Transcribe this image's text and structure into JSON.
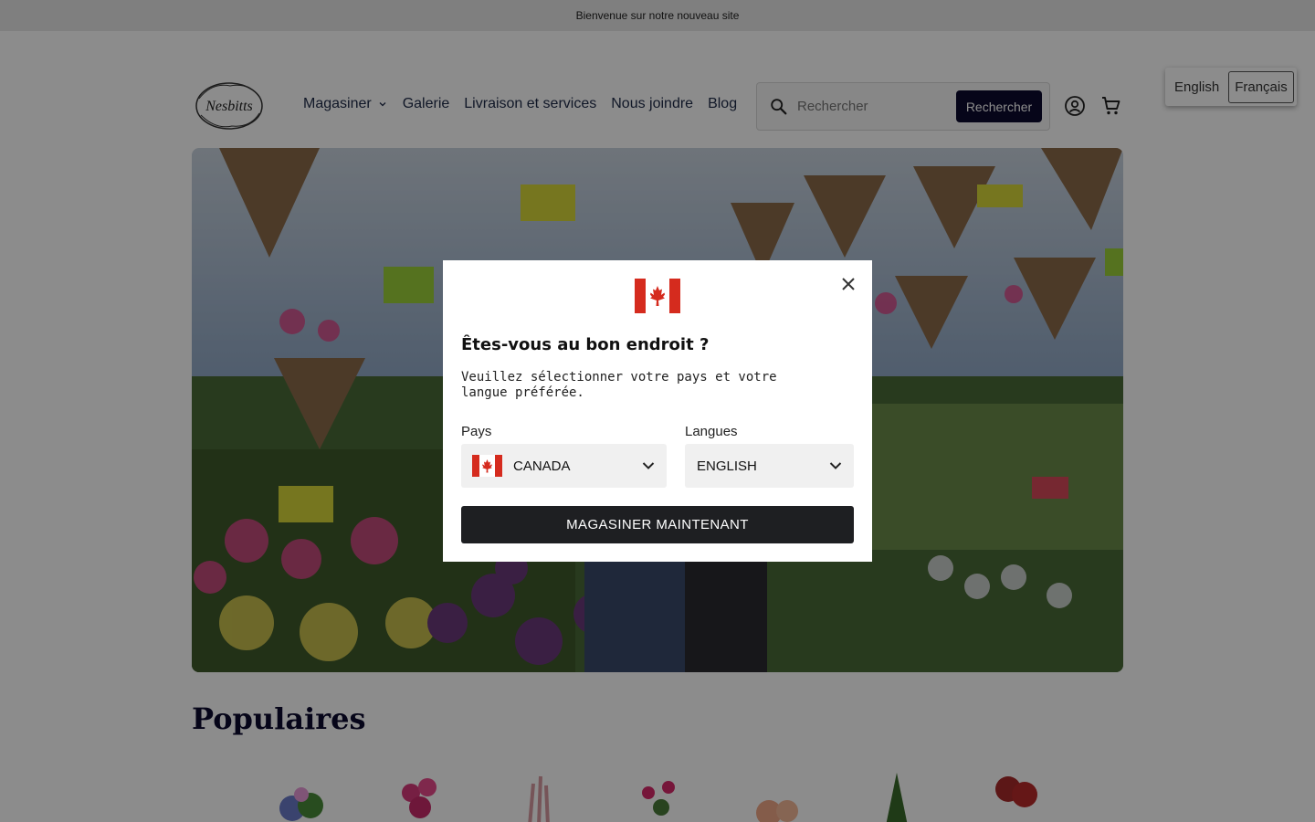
{
  "announcement": "Bienvenue sur notre nouveau site",
  "brand": {
    "logo_text": "Nesbitts"
  },
  "nav": {
    "items": [
      {
        "label": "Magasiner"
      },
      {
        "label": "Galerie"
      },
      {
        "label": "Livraison et services"
      },
      {
        "label": "Nous joindre"
      },
      {
        "label": "Blog"
      }
    ]
  },
  "search": {
    "placeholder": "Rechercher",
    "button_label": "Rechercher"
  },
  "language_switch": {
    "options": [
      "English",
      "Français"
    ],
    "active": "Français"
  },
  "hero": {
    "image_icon": "greenhouse-flowers-photo"
  },
  "populaires": {
    "title": "Populaires"
  },
  "modal": {
    "title": "Êtes-vous au bon endroit ?",
    "description": "Veuillez sélectionner votre pays et votre langue préférée.",
    "country_label": "Pays",
    "country_value": "CANADA",
    "language_label": "Langues",
    "language_value": "ENGLISH",
    "submit_label": "MAGASINER MAINTENANT"
  },
  "colors": {
    "brand_dark": "#0b0a2e",
    "modal_button": "#1e1f22",
    "flag_red": "#d52b1e"
  }
}
